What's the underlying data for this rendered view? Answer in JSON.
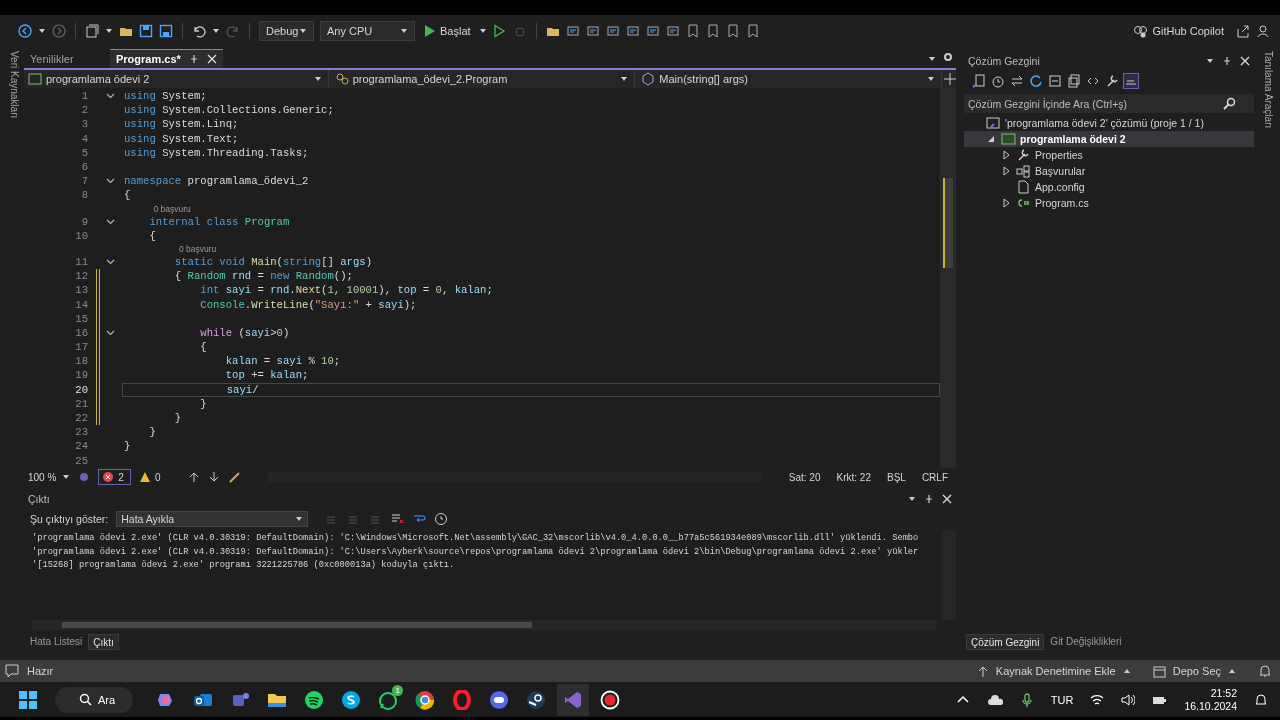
{
  "toolbar": {
    "configuration": "Debug",
    "platform": "Any CPU",
    "start_button": "Başlat",
    "copilot": "GitHub Copilot"
  },
  "left_strip": {
    "label": "Veri Kaynakları"
  },
  "right_strip": {
    "label": "Tanılama Araçları"
  },
  "editor": {
    "tabs": [
      {
        "label": "Yenilikler",
        "selected": false
      },
      {
        "label": "Program.cs*",
        "selected": true
      }
    ],
    "nav": [
      "programlama ödevi 2",
      "programlama_ödevi_2.Program",
      "Main(string[] args)"
    ],
    "lines": [
      {
        "number": "1",
        "fold": true,
        "modified": false,
        "current": false,
        "tokens": [
          {
            "kind": "kw",
            "text": "using"
          },
          {
            "kind": "pl",
            "text": " System;"
          }
        ]
      },
      {
        "number": "2",
        "fold": false,
        "modified": false,
        "current": false,
        "tokens": [
          {
            "kind": "kw",
            "text": "using"
          },
          {
            "kind": "pl",
            "text": " System.Collections.Generic;"
          }
        ]
      },
      {
        "number": "3",
        "fold": false,
        "modified": false,
        "current": false,
        "tokens": [
          {
            "kind": "kw",
            "text": "using"
          },
          {
            "kind": "pl",
            "text": " System.Linq;"
          }
        ]
      },
      {
        "number": "4",
        "fold": false,
        "modified": false,
        "current": false,
        "tokens": [
          {
            "kind": "kw",
            "text": "using"
          },
          {
            "kind": "pl",
            "text": " System.Text;"
          }
        ]
      },
      {
        "number": "5",
        "fold": false,
        "modified": false,
        "current": false,
        "tokens": [
          {
            "kind": "kw",
            "text": "using"
          },
          {
            "kind": "pl",
            "text": " System.Threading.Tasks;"
          }
        ]
      },
      {
        "number": "6",
        "fold": false,
        "modified": false,
        "current": false
      },
      {
        "number": "7",
        "fold": true,
        "modified": false,
        "current": false,
        "tokens": [
          {
            "kind": "kw",
            "text": "namespace"
          },
          {
            "kind": "pl",
            "text": " programlama_ödevi_2"
          }
        ]
      },
      {
        "number": "8",
        "fold": false,
        "modified": false,
        "current": false,
        "tokens": [
          {
            "kind": "pl",
            "text": "{"
          }
        ]
      },
      {
        "lens": "0 başvuru"
      },
      {
        "number": "9",
        "fold": true,
        "modified": false,
        "current": false,
        "tokens": [
          {
            "kind": "kw",
            "text": "    internal"
          },
          {
            "kind": "kw",
            "text": " class"
          },
          {
            "kind": "type",
            "text": " Program"
          }
        ]
      },
      {
        "number": "10",
        "fold": false,
        "modified": false,
        "current": false,
        "tokens": [
          {
            "kind": "pl",
            "text": "    {"
          }
        ]
      },
      {
        "lens": "0 başvuru"
      },
      {
        "number": "11",
        "fold": true,
        "modified": false,
        "current": false,
        "tokens": [
          {
            "kind": "kw",
            "text": "        static"
          },
          {
            "kind": "kw",
            "text": " void"
          },
          {
            "kind": "fn",
            "text": " Main"
          },
          {
            "kind": "pl",
            "text": "("
          },
          {
            "kind": "kw",
            "text": "string"
          },
          {
            "kind": "pl",
            "text": "[] "
          },
          {
            "kind": "id",
            "text": "args"
          },
          {
            "kind": "pl",
            "text": ")"
          }
        ]
      },
      {
        "number": "12",
        "fold": false,
        "modified": true,
        "current": false,
        "tokens": [
          {
            "kind": "pl",
            "text": "        {"
          },
          {
            "kind": "type",
            "text": " Random"
          },
          {
            "kind": "id",
            "text": " rnd"
          },
          {
            "kind": "pl",
            "text": " = "
          },
          {
            "kind": "kw",
            "text": "new"
          },
          {
            "kind": "type",
            "text": " Random"
          },
          {
            "kind": "pl",
            "text": "();"
          }
        ]
      },
      {
        "number": "13",
        "fold": false,
        "modified": true,
        "current": false,
        "tokens": [
          {
            "kind": "kw",
            "text": "            int"
          },
          {
            "kind": "id",
            "text": " sayi"
          },
          {
            "kind": "pl",
            "text": " = "
          },
          {
            "kind": "id",
            "text": "rnd"
          },
          {
            "kind": "pl",
            "text": "."
          },
          {
            "kind": "fn",
            "text": "Next"
          },
          {
            "kind": "pl",
            "text": "("
          },
          {
            "kind": "num",
            "text": "1"
          },
          {
            "kind": "pl",
            "text": ", "
          },
          {
            "kind": "num",
            "text": "10001"
          },
          {
            "kind": "pl",
            "text": "), "
          },
          {
            "kind": "id",
            "text": "top"
          },
          {
            "kind": "pl",
            "text": " = "
          },
          {
            "kind": "num",
            "text": "0"
          },
          {
            "kind": "pl",
            "text": ", "
          },
          {
            "kind": "id",
            "text": "kalan"
          },
          {
            "kind": "pl",
            "text": ";"
          }
        ]
      },
      {
        "number": "14",
        "fold": false,
        "modified": true,
        "current": false,
        "tokens": [
          {
            "kind": "type",
            "text": "            Console"
          },
          {
            "kind": "pl",
            "text": "."
          },
          {
            "kind": "fn",
            "text": "WriteLine"
          },
          {
            "kind": "pl",
            "text": "("
          },
          {
            "kind": "str",
            "text": "\"Sayı:\""
          },
          {
            "kind": "pl",
            "text": " + "
          },
          {
            "kind": "id",
            "text": "sayi"
          },
          {
            "kind": "pl",
            "text": ");"
          }
        ]
      },
      {
        "number": "15",
        "fold": false,
        "modified": true,
        "current": false
      },
      {
        "number": "16",
        "fold": true,
        "modified": true,
        "current": false,
        "tokens": [
          {
            "kind": "ctrl",
            "text": "            while"
          },
          {
            "kind": "pl",
            "text": " ("
          },
          {
            "kind": "id",
            "text": "sayi"
          },
          {
            "kind": "pl",
            "text": ">"
          },
          {
            "kind": "num",
            "text": "0"
          },
          {
            "kind": "pl",
            "text": ")"
          }
        ]
      },
      {
        "number": "17",
        "fold": false,
        "modified": true,
        "current": false,
        "tokens": [
          {
            "kind": "pl",
            "text": "            {"
          }
        ]
      },
      {
        "number": "18",
        "fold": false,
        "modified": true,
        "current": false,
        "tokens": [
          {
            "kind": "id",
            "text": "                kalan"
          },
          {
            "kind": "pl",
            "text": " = "
          },
          {
            "kind": "id",
            "text": "sayi"
          },
          {
            "kind": "pl",
            "text": " % "
          },
          {
            "kind": "num",
            "text": "10"
          },
          {
            "kind": "pl",
            "text": ";"
          }
        ]
      },
      {
        "number": "19",
        "fold": false,
        "modified": true,
        "current": false,
        "tokens": [
          {
            "kind": "id",
            "text": "                top"
          },
          {
            "kind": "pl",
            "text": " += "
          },
          {
            "kind": "id",
            "text": "kalan"
          },
          {
            "kind": "pl",
            "text": ";"
          }
        ]
      },
      {
        "number": "20",
        "fold": false,
        "modified": true,
        "current": true,
        "tokens": [
          {
            "kind": "id",
            "text": "                sayi"
          },
          {
            "kind": "pl",
            "text": "/"
          }
        ]
      },
      {
        "number": "21",
        "fold": false,
        "modified": true,
        "current": false,
        "tokens": [
          {
            "kind": "pl",
            "text": "            }"
          }
        ]
      },
      {
        "number": "22",
        "fold": false,
        "modified": true,
        "current": false,
        "tokens": [
          {
            "kind": "pl",
            "text": "        }"
          }
        ]
      },
      {
        "number": "23",
        "fold": false,
        "modified": false,
        "current": false,
        "tokens": [
          {
            "kind": "pl",
            "text": "    }"
          }
        ]
      },
      {
        "number": "24",
        "fold": false,
        "modified": false,
        "current": false,
        "tokens": [
          {
            "kind": "pl",
            "text": "}"
          }
        ]
      },
      {
        "number": "25",
        "fold": false,
        "modified": false,
        "current": false
      }
    ],
    "status": {
      "zoom": "100 %",
      "errors": "2",
      "warnings": "0",
      "line": "Sat: 20",
      "column": "Krkt: 22",
      "insert_mode": "BŞL",
      "line_ending": "CRLF"
    }
  },
  "output": {
    "title": "Çıktı",
    "source_label": "Şu çıktıyı göster:",
    "source": "Hata Ayıkla",
    "lines": [
      "'programlama ödevi 2.exe' (CLR v4.0.30319: DefaultDomain): 'C:\\Windows\\Microsoft.Net\\assembly\\GAC_32\\mscorlib\\v4.0_4.0.0.0__b77a5c561934e089\\mscorlib.dll' yüklendi. Sembo",
      "'programlama ödevi 2.exe' (CLR v4.0.30319: DefaultDomain): 'C:\\Users\\Ayberk\\source\\repos\\programlama ödevi 2\\programlama ödevi 2\\bin\\Debug\\programlama ödevi 2.exe' yükler",
      "'[15268] programlama ödevi 2.exe' programı 3221225786 (0xc000013a) koduyla çıktı."
    ],
    "tabs": [
      {
        "label": "Hata Listesi",
        "selected": false
      },
      {
        "label": "Çıktı",
        "selected": true
      }
    ]
  },
  "solution_explorer": {
    "title": "Çözüm Gezgini",
    "search": {
      "placeholder": "Çözüm Gezgini İçinde Ara (Ctrl+ş)"
    },
    "tree": [
      {
        "label": "'programlama ödevi 2' çözümü (proje 1 / 1)",
        "kind": "solution",
        "selected": false,
        "children": [
          {
            "label": "programlama ödevi 2",
            "kind": "project",
            "selected": true,
            "expanded": true,
            "children": [
              {
                "label": "Properties",
                "kind": "properties",
                "selected": false,
                "expanded": false
              },
              {
                "label": "Başvurular",
                "kind": "references",
                "selected": false,
                "expanded": false
              },
              {
                "label": "App.config",
                "kind": "config",
                "selected": false
              },
              {
                "label": "Program.cs",
                "kind": "csharp",
                "selected": false,
                "expanded": false
              }
            ]
          }
        ]
      }
    ],
    "tabs": [
      {
        "label": "Çözüm Gezgini",
        "selected": true
      },
      {
        "label": "Git Değişiklikleri",
        "selected": false
      }
    ]
  },
  "status_bar": {
    "state": "Hazır",
    "source_control": "Kaynak Denetimine Ekle",
    "repository": "Depo Seç"
  },
  "taskbar": {
    "search": "Ara",
    "chat_badge": "1",
    "language": "TUR",
    "time": "21:52",
    "date": "16.10.2024"
  }
}
